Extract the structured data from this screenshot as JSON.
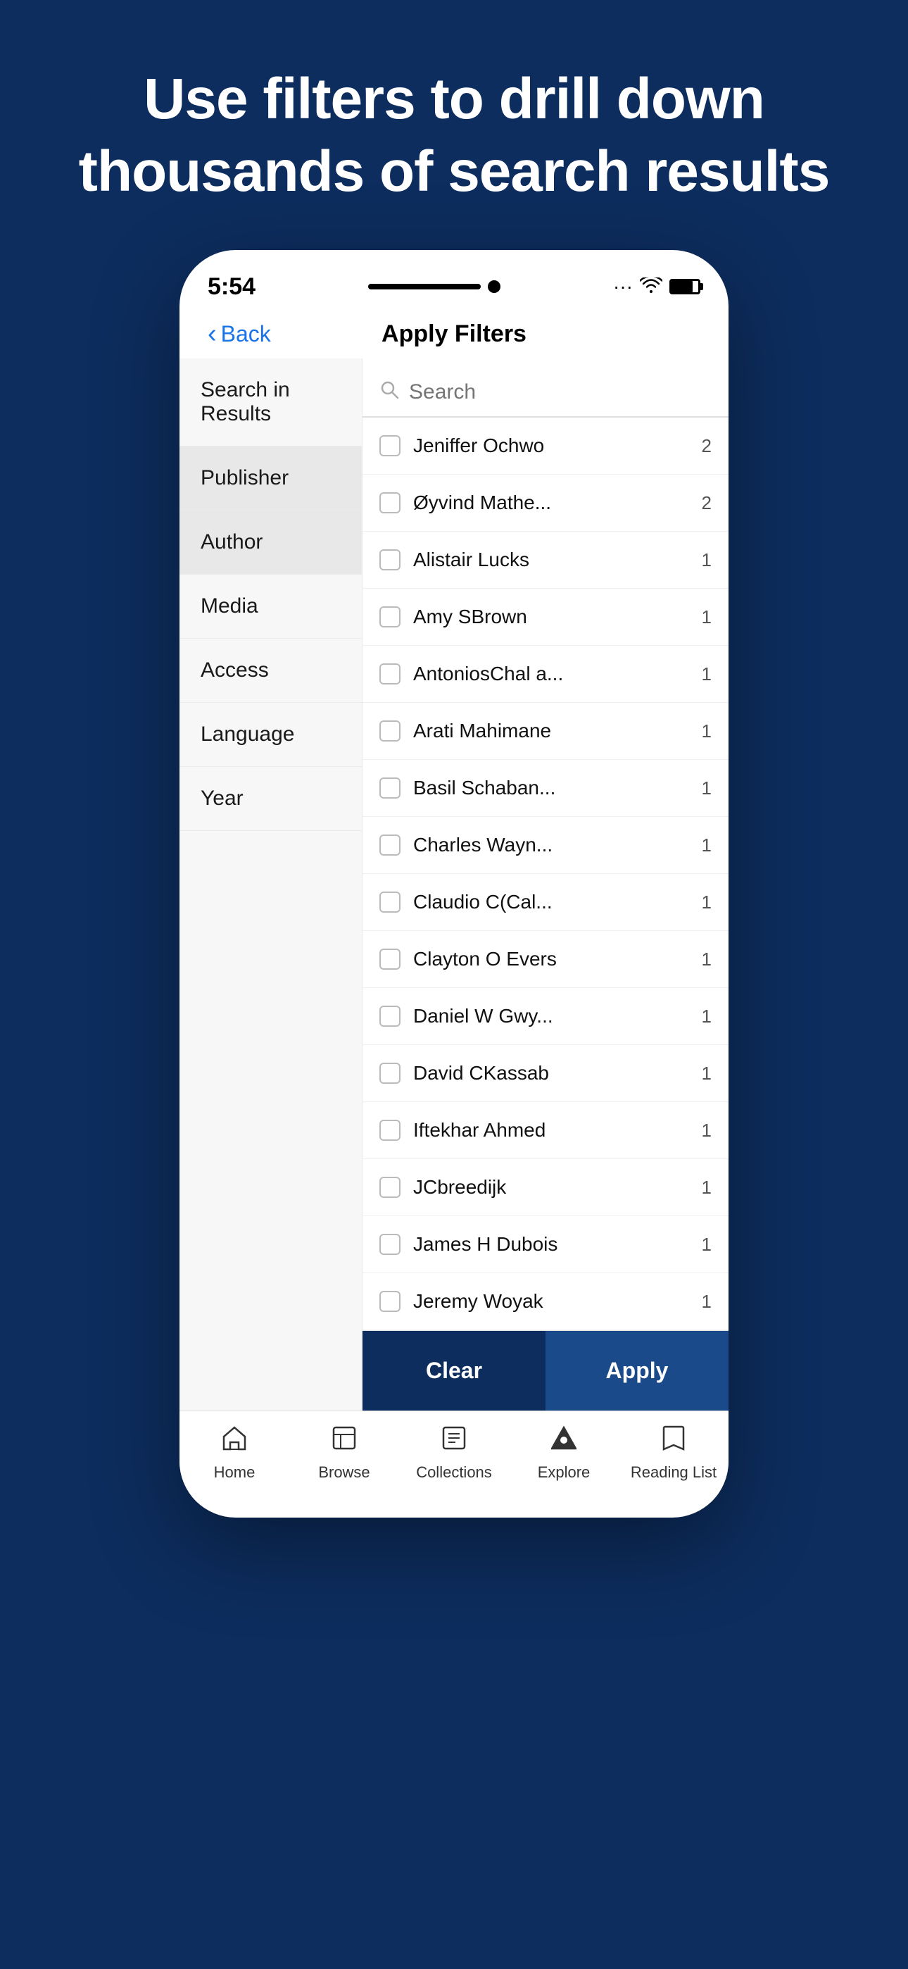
{
  "hero": {
    "title": "Use filters to drill down thousands of search results"
  },
  "status_bar": {
    "time": "5:54"
  },
  "header": {
    "back_label": "Back",
    "title": "Apply Filters"
  },
  "sidebar": {
    "items": [
      {
        "id": "search-in-results",
        "label": "Search in Results",
        "active": false
      },
      {
        "id": "publisher",
        "label": "Publisher",
        "active": false
      },
      {
        "id": "author",
        "label": "Author",
        "active": true
      },
      {
        "id": "media",
        "label": "Media",
        "active": false
      },
      {
        "id": "access",
        "label": "Access",
        "active": false
      },
      {
        "id": "language",
        "label": "Language",
        "active": false
      },
      {
        "id": "year",
        "label": "Year",
        "active": false
      }
    ]
  },
  "search": {
    "placeholder": "Search"
  },
  "filters": [
    {
      "label": "Jeniffer Ochwo",
      "count": "2"
    },
    {
      "label": "Øyvind Mathe...",
      "count": "2"
    },
    {
      "label": "Alistair Lucks",
      "count": "1"
    },
    {
      "label": "Amy SBrown",
      "count": "1"
    },
    {
      "label": "AntoniosChal a...",
      "count": "1"
    },
    {
      "label": "Arati Mahimane",
      "count": "1"
    },
    {
      "label": "Basil Schaban...",
      "count": "1"
    },
    {
      "label": "Charles Wayn...",
      "count": "1"
    },
    {
      "label": "Claudio C(Cal...",
      "count": "1"
    },
    {
      "label": "Clayton O Evers",
      "count": "1"
    },
    {
      "label": "Daniel W Gwy...",
      "count": "1"
    },
    {
      "label": "David CKassab",
      "count": "1"
    },
    {
      "label": "Iftekhar Ahmed",
      "count": "1"
    },
    {
      "label": "JCbreedijk",
      "count": "1"
    },
    {
      "label": "James H Dubois",
      "count": "1"
    },
    {
      "label": "Jeremy Woyak",
      "count": "1"
    }
  ],
  "buttons": {
    "clear": "Clear",
    "apply": "Apply"
  },
  "tab_bar": {
    "items": [
      {
        "id": "home",
        "icon": "🏠",
        "label": "Home"
      },
      {
        "id": "browse",
        "icon": "🔍",
        "label": "Browse"
      },
      {
        "id": "collections",
        "icon": "📋",
        "label": "Collections"
      },
      {
        "id": "explore",
        "icon": "▲",
        "label": "Explore"
      },
      {
        "id": "reading-list",
        "icon": "🔖",
        "label": "Reading List"
      }
    ]
  }
}
